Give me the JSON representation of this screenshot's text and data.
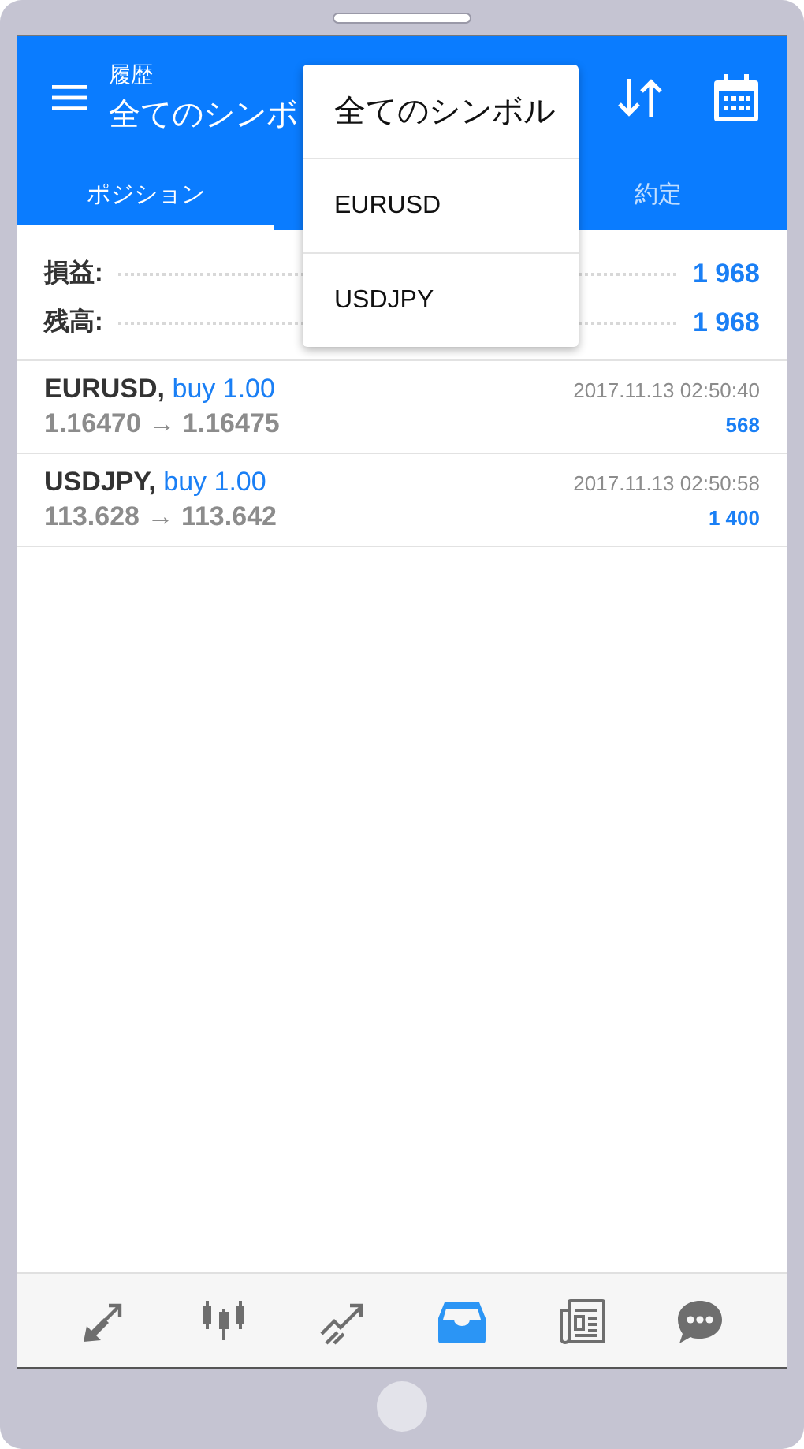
{
  "header": {
    "subtitle": "履歴",
    "title": "全てのシンボ"
  },
  "tabs": [
    {
      "label": "ポジション",
      "selected": true
    },
    {
      "label": "約定",
      "selected": false
    }
  ],
  "dropdown": {
    "items": [
      "全てのシンボル",
      "EURUSD",
      "USDJPY"
    ]
  },
  "summary": [
    {
      "label": "損益:",
      "value": "1 968"
    },
    {
      "label": "残高:",
      "value": "1 968"
    }
  ],
  "deals": [
    {
      "symbol": "EURUSD,",
      "action": "buy 1.00",
      "prices": "1.16470 → 1.16475",
      "time": "2017.11.13 02:50:40",
      "profit": "568"
    },
    {
      "symbol": "USDJPY,",
      "action": "buy 1.00",
      "prices": "113.628 → 113.642",
      "time": "2017.11.13 02:50:58",
      "profit": "1 400"
    }
  ],
  "nav": [
    {
      "kind": "trade",
      "selected": false
    },
    {
      "kind": "quotes",
      "selected": false
    },
    {
      "kind": "chart",
      "selected": false
    },
    {
      "kind": "history",
      "selected": true
    },
    {
      "kind": "news",
      "selected": false
    },
    {
      "kind": "chat",
      "selected": false
    }
  ]
}
